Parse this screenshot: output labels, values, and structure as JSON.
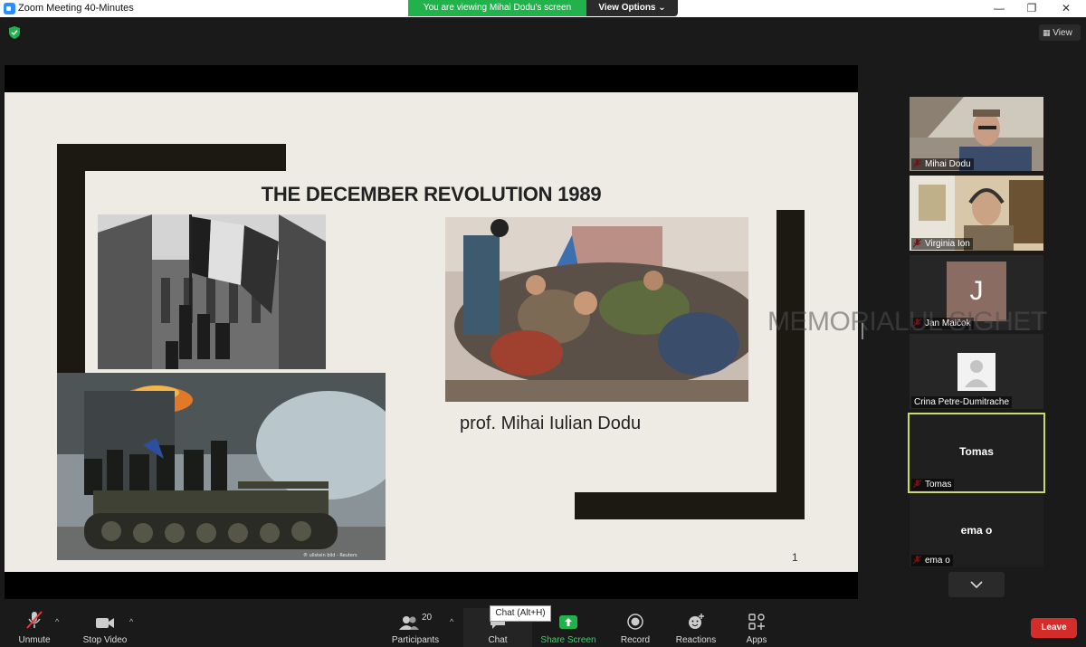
{
  "window": {
    "title": "Zoom Meeting 40-Minutes",
    "banner": "You are viewing Mihai Dodu's screen",
    "view_options": "View Options",
    "view_button": "View"
  },
  "slide": {
    "title": "THE DECEMBER REVOLUTION 1989",
    "author": "prof. Mihai Iulian Dodu",
    "page_number": "1",
    "photo_credit": "® ullstein bild - Reuters"
  },
  "participants": [
    {
      "name": "Mihai Dodu",
      "muted": true
    },
    {
      "name": "Virginia Ion",
      "muted": true
    },
    {
      "name": "Jan Malčok",
      "initial": "J",
      "muted": true
    },
    {
      "name": "Crina Petre-Dumitrache",
      "muted": false
    },
    {
      "name": "Tomas",
      "display": "Tomas",
      "muted": true,
      "active_speaker": true
    },
    {
      "name": "ema o",
      "display": "ema o",
      "muted": true
    }
  ],
  "watermark": "MEMORIALUL SIGHET",
  "toolbar": {
    "unmute": "Unmute",
    "stop_video": "Stop Video",
    "participants": "Participants",
    "participants_count": "20",
    "chat": "Chat",
    "chat_tooltip": "Chat (Alt+H)",
    "share_screen": "Share Screen",
    "record": "Record",
    "reactions": "Reactions",
    "apps": "Apps",
    "leave": "Leave"
  },
  "colors": {
    "banner_green": "#22b24c",
    "leave_red": "#d42b2b",
    "active_speaker_border": "#c9d96b",
    "slide_bg": "#eeebe5"
  }
}
